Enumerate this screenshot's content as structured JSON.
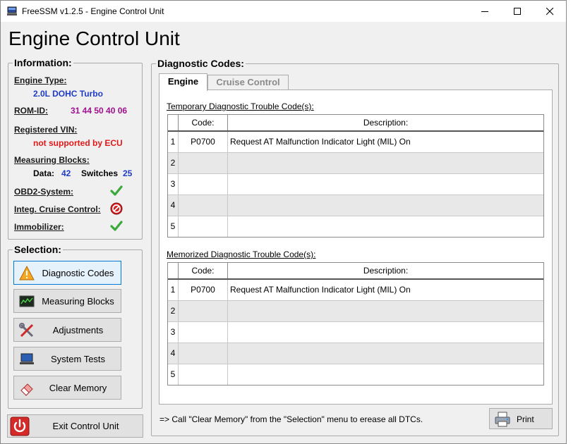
{
  "window": {
    "title": "FreeSSM v1.2.5 - Engine Control Unit"
  },
  "app_title": "Engine Control Unit",
  "information": {
    "legend": "Information:",
    "engine_type_label": "Engine Type:",
    "engine_type_value": "2.0L DOHC Turbo",
    "rom_id_label": "ROM-ID:",
    "rom_id_value": "31 44 50 40 06",
    "vin_label": "Registered VIN:",
    "vin_value": "not supported by ECU",
    "measuring_blocks_label": "Measuring Blocks:",
    "data_label": "Data:",
    "data_value": "42",
    "switches_label": "Switches",
    "switches_value": "25",
    "obd2_label": "OBD2-System:",
    "cruise_label": "Integ. Cruise Control:",
    "immobilizer_label": "Immobilizer:",
    "status_icons": {
      "obd2": "checkmark-icon",
      "cruise": "no-entry-icon",
      "immobilizer": "checkmark-icon"
    },
    "colors": {
      "value_blue": "#1e3cc8",
      "value_purple": "#a01090",
      "value_red": "#e01818",
      "check_green": "#3aa83a"
    }
  },
  "selection": {
    "legend": "Selection:",
    "buttons": [
      {
        "label": "Diagnostic Codes",
        "icon": "warning-icon"
      },
      {
        "label": "Measuring Blocks",
        "icon": "monitor-graph-icon"
      },
      {
        "label": "Adjustments",
        "icon": "tools-icon"
      },
      {
        "label": "System Tests",
        "icon": "laptop-icon"
      },
      {
        "label": "Clear Memory",
        "icon": "eraser-icon"
      }
    ]
  },
  "exit_button": {
    "label": "Exit Control Unit",
    "icon": "power-icon"
  },
  "diagnostic": {
    "legend": "Diagnostic Codes:",
    "tabs": [
      {
        "label": "Engine"
      },
      {
        "label": "Cruise Control"
      }
    ],
    "temporary": {
      "caption": "Temporary Diagnostic Trouble Code(s):",
      "code_header": "Code:",
      "desc_header": "Description:",
      "rows": [
        {
          "num": "1",
          "code": "P0700",
          "desc": "Request AT Malfunction Indicator Light (MIL) On"
        },
        {
          "num": "2",
          "code": "",
          "desc": ""
        },
        {
          "num": "3",
          "code": "",
          "desc": ""
        },
        {
          "num": "4",
          "code": "",
          "desc": ""
        },
        {
          "num": "5",
          "code": "",
          "desc": ""
        }
      ]
    },
    "memorized": {
      "caption": "Memorized Diagnostic Trouble Code(s):",
      "code_header": "Code:",
      "desc_header": "Description:",
      "rows": [
        {
          "num": "1",
          "code": "P0700",
          "desc": "Request AT Malfunction Indicator Light (MIL) On"
        },
        {
          "num": "2",
          "code": "",
          "desc": ""
        },
        {
          "num": "3",
          "code": "",
          "desc": ""
        },
        {
          "num": "4",
          "code": "",
          "desc": ""
        },
        {
          "num": "5",
          "code": "",
          "desc": ""
        }
      ]
    },
    "hint": "=> Call \"Clear Memory\" from the \"Selection\" menu to erease all DTCs.",
    "print_label": "Print",
    "print_icon": "printer-icon"
  }
}
